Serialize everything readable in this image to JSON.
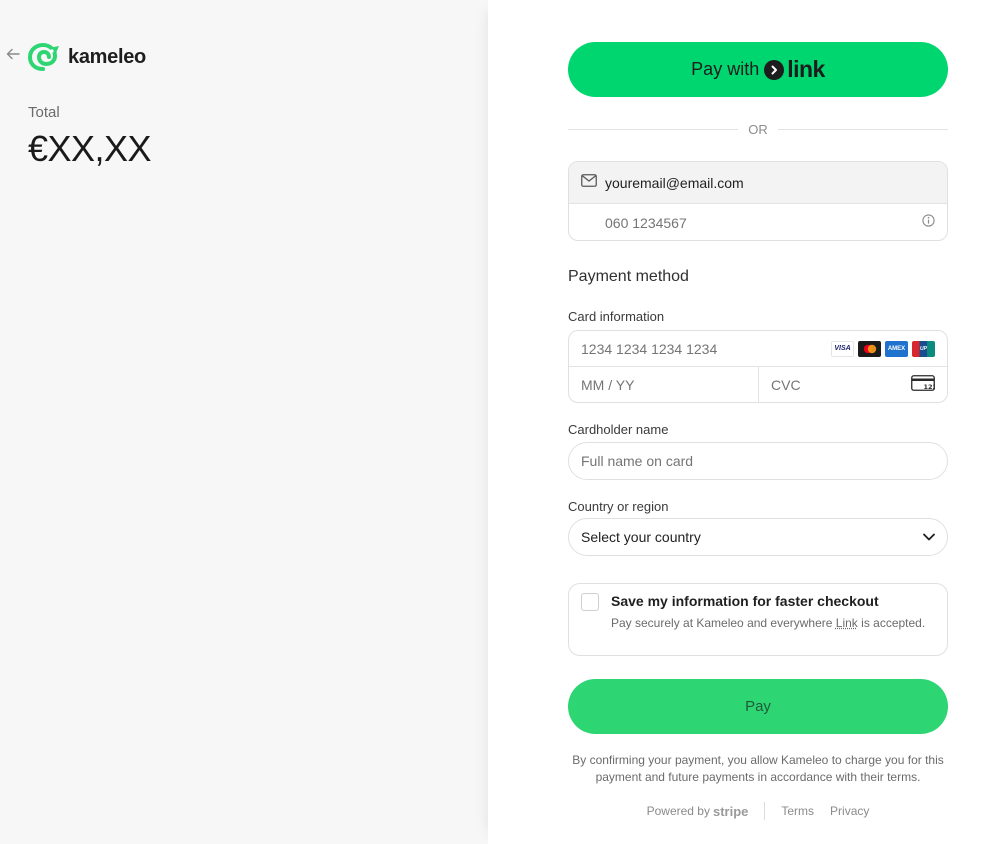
{
  "summary": {
    "brand_name": "kameleo",
    "back_icon": "arrow-left-icon",
    "total_label": "Total",
    "total_amount": "€XX,XX"
  },
  "checkout": {
    "link_button": {
      "prefix": "Pay with",
      "link_word": "link",
      "color": "#00d66f"
    },
    "divider_text": "OR",
    "contact": {
      "email_icon": "envelope-icon",
      "email_value": "youremail@email.com",
      "phone_placeholder": "060 1234567",
      "phone_info_icon": "info-icon"
    },
    "payment_method_title": "Payment method",
    "card": {
      "label": "Card information",
      "number_placeholder": "1234 1234 1234 1234",
      "expiry_placeholder": "MM / YY",
      "cvc_placeholder": "CVC",
      "brands": [
        "VISA",
        "Mastercard",
        "AMEX",
        "UnionPay"
      ]
    },
    "cardholder": {
      "label": "Cardholder name",
      "placeholder": "Full name on card"
    },
    "country": {
      "label": "Country or region",
      "selected": "Select your country"
    },
    "save_info": {
      "title": "Save my information for faster checkout",
      "desc_before": "Pay securely at Kameleo and everywhere",
      "desc_link": "Link",
      "desc_after": "is accepted."
    },
    "pay_button": {
      "label": "Pay",
      "color": "#2ed573"
    },
    "consent_text": "By confirming your payment, you allow Kameleo to charge you for this payment and future payments in accordance with their terms.",
    "footer": {
      "powered_by": "Powered by",
      "stripe": "stripe",
      "terms": "Terms",
      "privacy": "Privacy"
    }
  }
}
